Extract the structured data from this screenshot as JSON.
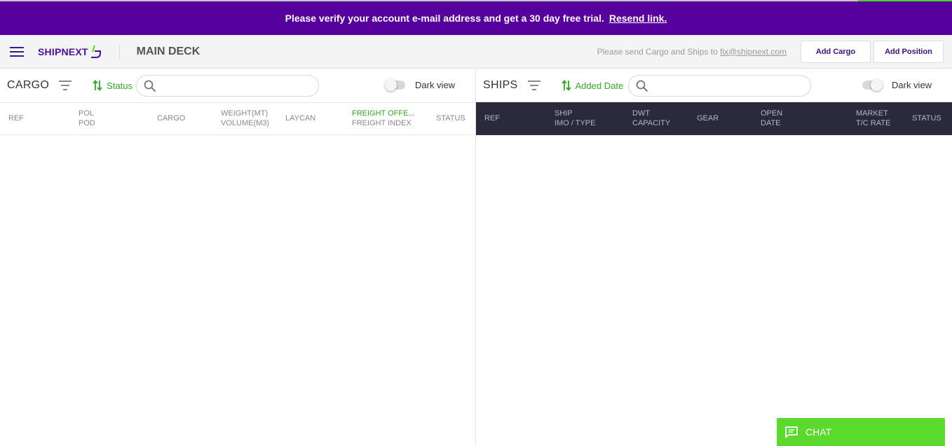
{
  "banner": {
    "message": "Please verify your account e-mail address and get a 30 day free trial.",
    "link": "Resend link."
  },
  "header": {
    "logo_text": "SHIPNEXT",
    "title": "MAIN DECK",
    "send_note": "Please send Cargo and Ships to",
    "send_email": "fix@shipnext.com",
    "add_cargo": "Add Cargo",
    "add_position": "Add Position"
  },
  "cargo": {
    "title": "CARGO",
    "sort_label": "Status",
    "dark_view": "Dark view",
    "columns": {
      "ref": "REF",
      "pol": "POL",
      "pod": "POD",
      "cargo": "CARGO",
      "weight": "WEIGHT(MT)",
      "volume": "VOLUME(M3)",
      "laycan": "LAYCAN",
      "freight_offer": "FREIGHT OFFE...",
      "freight_index": "FREIGHT INDEX",
      "status": "STATUS"
    }
  },
  "ships": {
    "title": "SHIPS",
    "sort_label": "Added Date",
    "dark_view": "Dark view",
    "columns": {
      "ref": "REF",
      "ship": "SHIP",
      "imo_type": "IMO / TYPE",
      "dwt": "DWT",
      "capacity": "CAPACITY",
      "gear": "GEAR",
      "open": "OPEN",
      "date": "DATE",
      "market": "MARKET",
      "tc_rate": "T/C RATE",
      "status": "STATUS"
    }
  },
  "chat": {
    "label": "CHAT"
  },
  "colors": {
    "brand_purple": "#56009e",
    "accent_green": "#2eaa1e",
    "chat_green": "#5bd92c",
    "dark_header": "#2b2a3a"
  }
}
